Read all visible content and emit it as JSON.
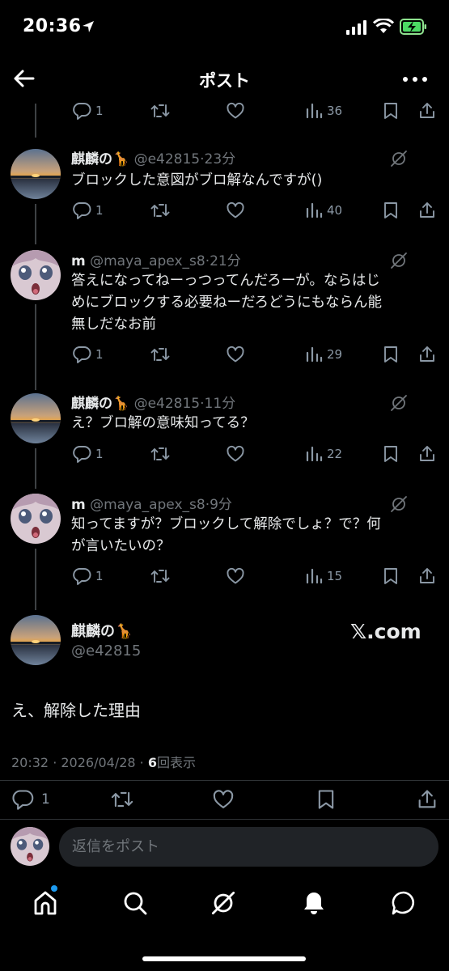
{
  "status_bar": {
    "time": "20:36"
  },
  "header": {
    "title": "ポスト"
  },
  "top_actions": {
    "reply_count": "1",
    "views": "36"
  },
  "tweets": [
    {
      "name": "麒麟の🦒",
      "handle": "@e42815",
      "time": "23分",
      "lines": [
        "ブロックした意図がブロ解なんですが()"
      ],
      "reply_count": "1",
      "views": "40"
    },
    {
      "name": "m",
      "handle": "@maya_apex_s8",
      "time": "21分",
      "lines": [
        "答えになってねーっつってんだろーが。ならはじ",
        "めにブロックする必要ねーだろどうにもならん能",
        "無しだなお前"
      ],
      "reply_count": "1",
      "views": "29"
    },
    {
      "name": "麒麟の🦒",
      "handle": "@e42815",
      "time": "11分",
      "lines": [
        "え？ブロ解の意味知ってる？"
      ],
      "reply_count": "1",
      "views": "22"
    },
    {
      "name": "m",
      "handle": "@maya_apex_s8",
      "time": "9分",
      "lines": [
        "知ってますが？ブロックして解除でしょ？で？何",
        "が言いたいの？"
      ],
      "reply_count": "1",
      "views": "15"
    }
  ],
  "main_post": {
    "name": "麒麟の🦒",
    "handle": "@e42815",
    "badge": "𝕏.com",
    "text": "え、解除した理由",
    "timestamp": "20:32 · 2026/04/28 · ",
    "views_count": "6",
    "views_label": "回表示",
    "reply_count": "1"
  },
  "reply_bar": {
    "placeholder": "返信をポスト"
  },
  "colors": {
    "background": "#000000",
    "text": "#e7e9ea",
    "muted": "#71767b",
    "accent": "#1d9bf0",
    "line": "#3e4144"
  },
  "icons": [
    "location-arrow",
    "signal",
    "wifi",
    "battery-charging",
    "back-arrow",
    "more-dots",
    "reply",
    "repost",
    "like",
    "views",
    "bookmark",
    "share",
    "grok",
    "home",
    "search",
    "grok-tab",
    "bell",
    "messages"
  ]
}
